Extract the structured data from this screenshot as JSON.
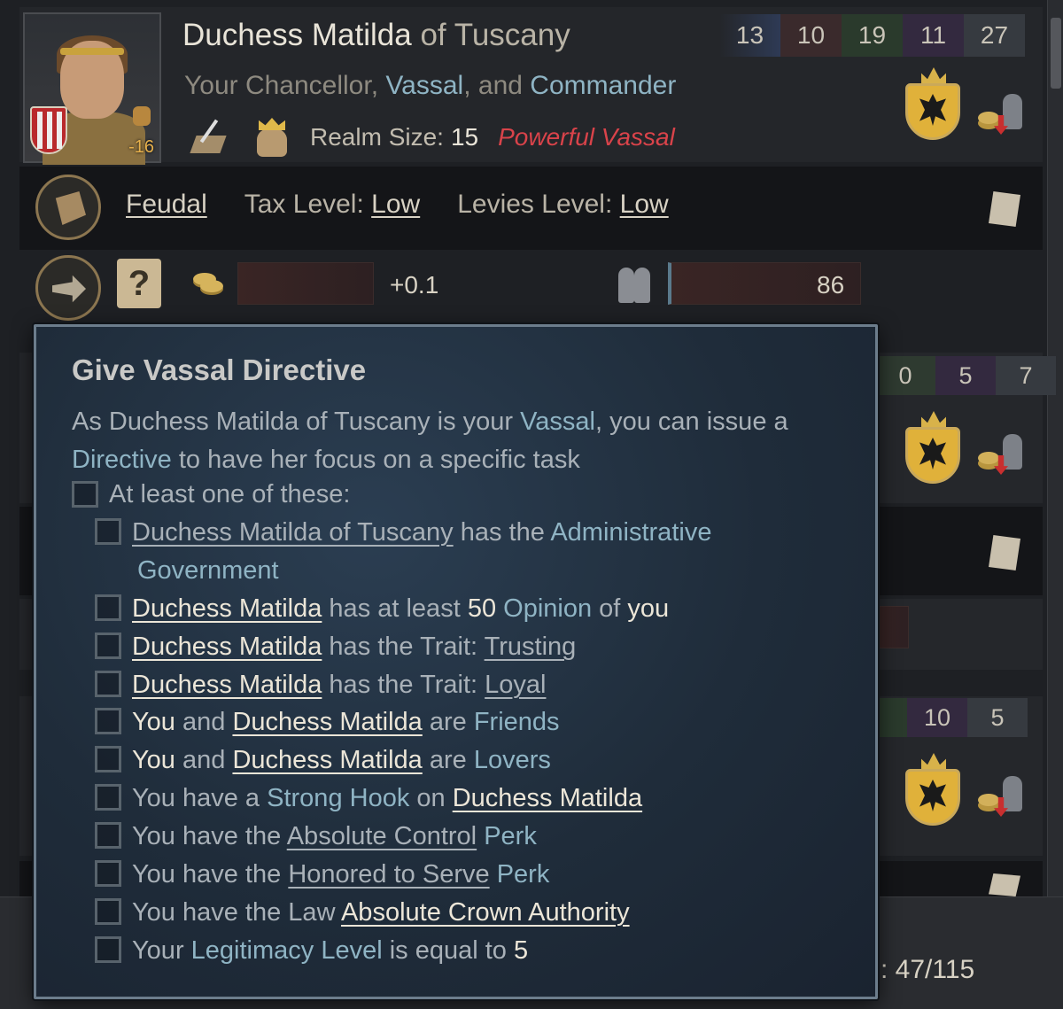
{
  "vassal": {
    "name_first": "Duchess Matilda",
    "name_of": "of Tuscany",
    "relation_prefix": "Your Chancellor,",
    "relation_vassal": "Vassal",
    "relation_and": ", and",
    "relation_commander": "Commander",
    "realm_size_label": "Realm Size:",
    "realm_size_value": "15",
    "powerful_label": "Powerful Vassal",
    "opinion": "-16",
    "skills": [
      "13",
      "10",
      "19",
      "11",
      "27"
    ]
  },
  "government": {
    "type": "Feudal",
    "tax_label": "Tax Level:",
    "tax_value": "Low",
    "levies_label": "Levies Level:",
    "levies_value": "Low"
  },
  "actions": {
    "directive_unknown": "?",
    "income": "+0.1",
    "levies": "86"
  },
  "other_cards": {
    "card2_skills": [
      "0",
      "5",
      "7"
    ],
    "card3_skills": [
      "10",
      "5"
    ],
    "vassal_count": ": 47/115"
  },
  "tooltip": {
    "title": "Give Vassal Directive",
    "desc_1": "As ",
    "desc_name": "Duchess Matilda of Tuscany",
    "desc_2": " is your ",
    "desc_vassal": "Vassal",
    "desc_3": ", you can issue a",
    "desc_directive": "Directive",
    "desc_4": " to have her focus on a specific task",
    "at_least": "At least one of these:",
    "req1_name": "Duchess Matilda of Tuscany",
    "req1_mid": " has the ",
    "req1_gov": "Administrative",
    "req1_gov2": "Government",
    "req2_name": "Duchess Matilda",
    "req2_mid": " has at least ",
    "req2_num": "50",
    "req2_op": "Opinion",
    "req2_of": " of ",
    "req2_you": "you",
    "req3_name": "Duchess Matilda",
    "req3_mid": " has the Trait: ",
    "req3_trait": "Trusting",
    "req4_name": "Duchess Matilda",
    "req4_mid": " has the Trait: ",
    "req4_trait": "Loyal",
    "req5_you": "You",
    "req5_and": " and ",
    "req5_name": "Duchess Matilda",
    "req5_are": " are ",
    "req5_rel": "Friends",
    "req6_you": "You",
    "req6_and": " and ",
    "req6_name": "Duchess Matilda",
    "req6_are": " are ",
    "req6_rel": "Lovers",
    "req7_pre": "You have a ",
    "req7_hook": "Strong Hook",
    "req7_on": " on ",
    "req7_name": "Duchess Matilda",
    "req8_pre": "You have the ",
    "req8_perk": "Absolute Control",
    "req8_post": "Perk",
    "req9_pre": "You have the ",
    "req9_perk": "Honored to Serve",
    "req9_post": "Perk",
    "req10_pre": "You have the Law ",
    "req10_law": "Absolute Crown Authority",
    "req11_pre": "Your ",
    "req11_leg": "Legitimacy Level",
    "req11_mid": " is equal to ",
    "req11_num": "5"
  },
  "colors": {
    "accent_blue": "#8fb4c4",
    "powerful_red": "#d9434a",
    "opinion_orange": "#e6b04c"
  },
  "icons": [
    "fist-icon",
    "sword-map-icon",
    "crown-icon",
    "coat-of-arms-icon",
    "gold-troops-icon",
    "government-icon",
    "scroll-icon",
    "directive-hand-icon",
    "unknown-directive-icon",
    "gold-icon",
    "levies-icon"
  ]
}
